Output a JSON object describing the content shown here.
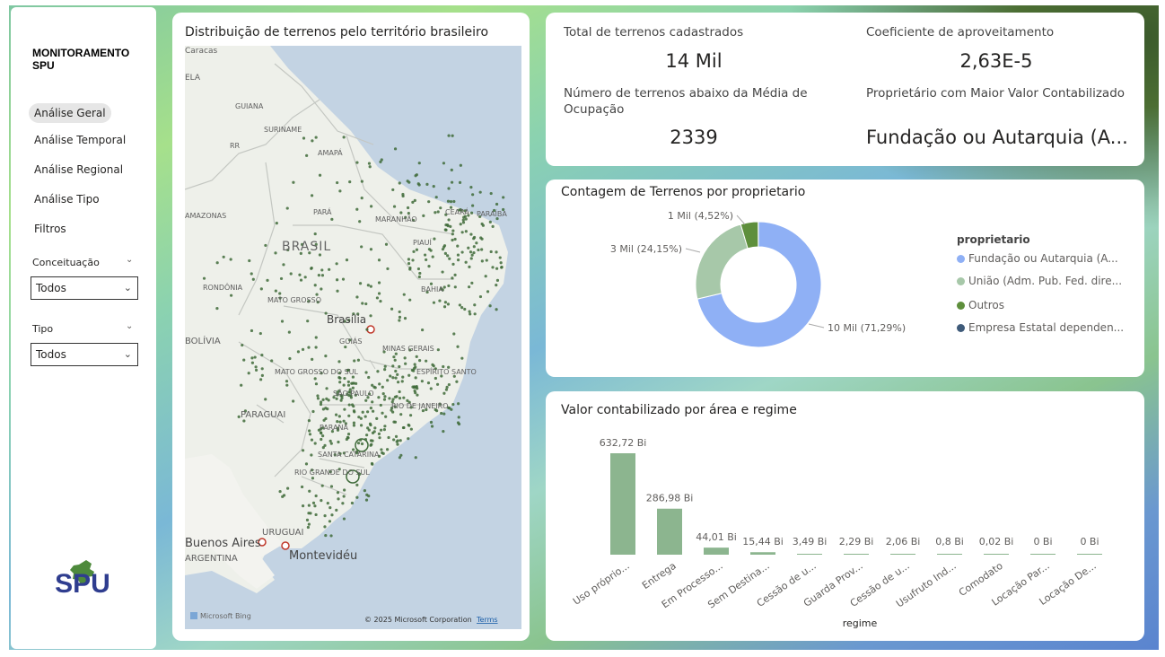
{
  "sidebar": {
    "brand": "MONITORAMENTO SPU",
    "nav": [
      {
        "label": "Análise Geral",
        "active": true
      },
      {
        "label": "Análise Temporal",
        "active": false
      },
      {
        "label": "Análise Regional",
        "active": false
      },
      {
        "label": "Análise Tipo",
        "active": false
      },
      {
        "label": "Filtros",
        "active": false
      }
    ],
    "slicers": [
      {
        "label": "Conceituação",
        "value": "Todos"
      },
      {
        "label": "Tipo",
        "value": "Todos"
      }
    ],
    "logo_text": "SPU"
  },
  "map": {
    "title": "Distribuição de terrenos pelo território brasileiro",
    "labels": [
      "Caracas",
      "ELA",
      "GUIANA",
      "SURINAME",
      "RR",
      "AMAPÁ",
      "AMAZONAS",
      "PARÁ",
      "MARANHÃO",
      "CEARÁ",
      "PARAÍBA",
      "BRASIL",
      "PIAUÍ",
      "RONDÔNIA",
      "MATO GROSSO",
      "BAHIA",
      "Brasília",
      "BOLÍVIA",
      "GOIÁS",
      "MINAS GERAIS",
      "MATO GROSSO DO SUL",
      "ESPÍRITO SANTO",
      "SÃO PAULO",
      "RIO DE JANEIRO",
      "PARAGUAI",
      "PARANÁ",
      "SANTA CATARINA",
      "RIO GRANDE DO SUL",
      "URUGUAI",
      "Buenos Aires",
      "ARGENTINA",
      "Montevidéu"
    ],
    "attribution_logo": "Microsoft Bing",
    "copyright": "© 2025 Microsoft Corporation",
    "terms": "Terms",
    "point_color": "#3f6b3a"
  },
  "kpis": {
    "total_label": "Total de terrenos cadastrados",
    "total_value": "14 Mil",
    "coef_label": "Coeficiente de aproveitamento",
    "coef_value": "2,63E-5",
    "below_label": "Número de terrenos abaixo da Média de Ocupação",
    "below_value": "2339",
    "owner_label": "Proprietário com Maior Valor Contabilizado",
    "owner_value": "Fundação ou Autarquia (A..."
  },
  "donut": {
    "title": "Contagem de Terrenos por proprietario",
    "legend_title": "proprietario",
    "legend": [
      {
        "label": "Fundação ou Autarquia (A...",
        "color": "#8fb0f5"
      },
      {
        "label": "União (Adm. Pub. Fed. dire...",
        "color": "#a7c8a9"
      },
      {
        "label": "Outros",
        "color": "#5e8f3c"
      },
      {
        "label": "Empresa Estatal dependen...",
        "color": "#3f5b7a"
      }
    ],
    "data_labels": [
      "10 Mil (71,29%)",
      "3 Mil (24,15%)",
      "1 Mil (4,52%)"
    ]
  },
  "chart_data": [
    {
      "type": "pie",
      "title": "Contagem de Terrenos por proprietario",
      "legend_title": "proprietario",
      "categories": [
        "Fundação ou Autarquia (A...",
        "União (Adm. Pub. Fed. dire...",
        "Outros",
        "Empresa Estatal dependen..."
      ],
      "values": [
        71.29,
        24.15,
        4.52,
        0.04
      ],
      "value_labels": [
        "10 Mil (71,29%)",
        "3 Mil (24,15%)",
        "1 Mil (4,52%)",
        ""
      ],
      "colors": [
        "#8fb0f5",
        "#a7c8a9",
        "#5e8f3c",
        "#3f5b7a"
      ],
      "donut": true,
      "legend_position": "right"
    },
    {
      "type": "bar",
      "title": "Valor contabilizado por área e regime",
      "xlabel": "regime",
      "ylabel": "",
      "categories": [
        "Uso próprio...",
        "Entrega",
        "Em Processo...",
        "Sem Destina...",
        "Cessão de u...",
        "Guarda Prov...",
        "Cessão de u...",
        "Usufruto Ind...",
        "Comodato",
        "Locação Par...",
        "Locação De..."
      ],
      "values": [
        632.72,
        286.98,
        44.01,
        15.44,
        3.49,
        2.29,
        2.06,
        0.8,
        0.02,
        0,
        0
      ],
      "value_labels": [
        "632,72 Bi",
        "286,98 Bi",
        "44,01 Bi",
        "15,44 Bi",
        "3,49 Bi",
        "2,29 Bi",
        "2,06 Bi",
        "0,8 Bi",
        "0,02 Bi",
        "0 Bi",
        "0 Bi"
      ],
      "color": "#8cb58f",
      "grid": false
    }
  ]
}
